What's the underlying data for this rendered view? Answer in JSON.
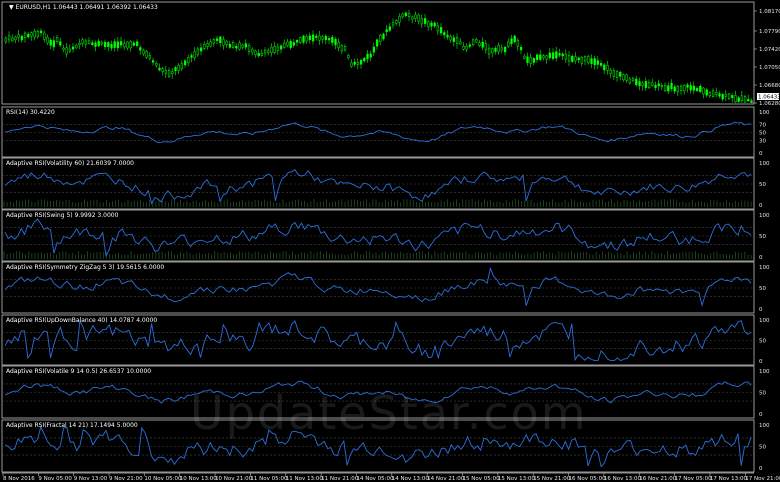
{
  "colors": {
    "background": "#000000",
    "candle": "#00ff00",
    "rsi_line": "#2d6fdc",
    "grid": "#444444",
    "frame": "#bfbfbf",
    "text": "#e8e8e8",
    "price_tag": "#ffffff"
  },
  "main": {
    "title": "EURUSD,H1  1.06443 1.06491 1.06392 1.06433",
    "price_labels": [
      "1.08170",
      "1.07790",
      "1.07420",
      "1.07050",
      "1.06680",
      "1.06433",
      "1.06280"
    ],
    "current_price": "1.06433"
  },
  "panes": [
    {
      "title": "RSI(14) 30.4220",
      "levels": [
        "100",
        "70",
        "50",
        "30",
        "0"
      ]
    },
    {
      "title": "Adaptive RSI(Volatility 60) 21.6039 7.0000",
      "levels": [
        "100",
        "50",
        "0"
      ]
    },
    {
      "title": "Adaptive RSI(Swing 5) 9.9992 3.0000",
      "levels": [
        "100",
        "50",
        "0"
      ]
    },
    {
      "title": "Adaptive RSI(Symmetry ZigZag 5 3) 19.5615 6.0000",
      "levels": [
        "100",
        "50",
        "0"
      ]
    },
    {
      "title": "Adaptive RSI(UpDownBalance 40) 14.0787 4.0000",
      "levels": [
        "100",
        "50",
        "0"
      ]
    },
    {
      "title": "Adaptive RSI(Volatile 9 14 0.5) 26.6537 10.0000",
      "levels": [
        "100",
        "50",
        "0"
      ]
    },
    {
      "title": "Adaptive RSI(Fractal 14 21) 17.1494 5.0000",
      "levels": [
        "100",
        "50",
        "0"
      ]
    }
  ],
  "time_labels": [
    "8 Nov 2016",
    "9 Nov 05:00",
    "9 Nov 13:00",
    "9 Nov 21:00",
    "10 Nov 05:00",
    "10 Nov 13:00",
    "10 Nov 21:00",
    "11 Nov 05:00",
    "11 Nov 13:00",
    "11 Nov 21:00",
    "14 Nov 05:00",
    "14 Nov 13:00",
    "14 Nov 21:00",
    "15 Nov 05:00",
    "15 Nov 13:00",
    "15 Nov 21:00",
    "16 Nov 05:00",
    "16 Nov 13:00",
    "16 Nov 21:00",
    "17 Nov 05:00",
    "17 Nov 13:00",
    "17 Nov 21:00"
  ],
  "watermark": "UpdateStar.com"
}
